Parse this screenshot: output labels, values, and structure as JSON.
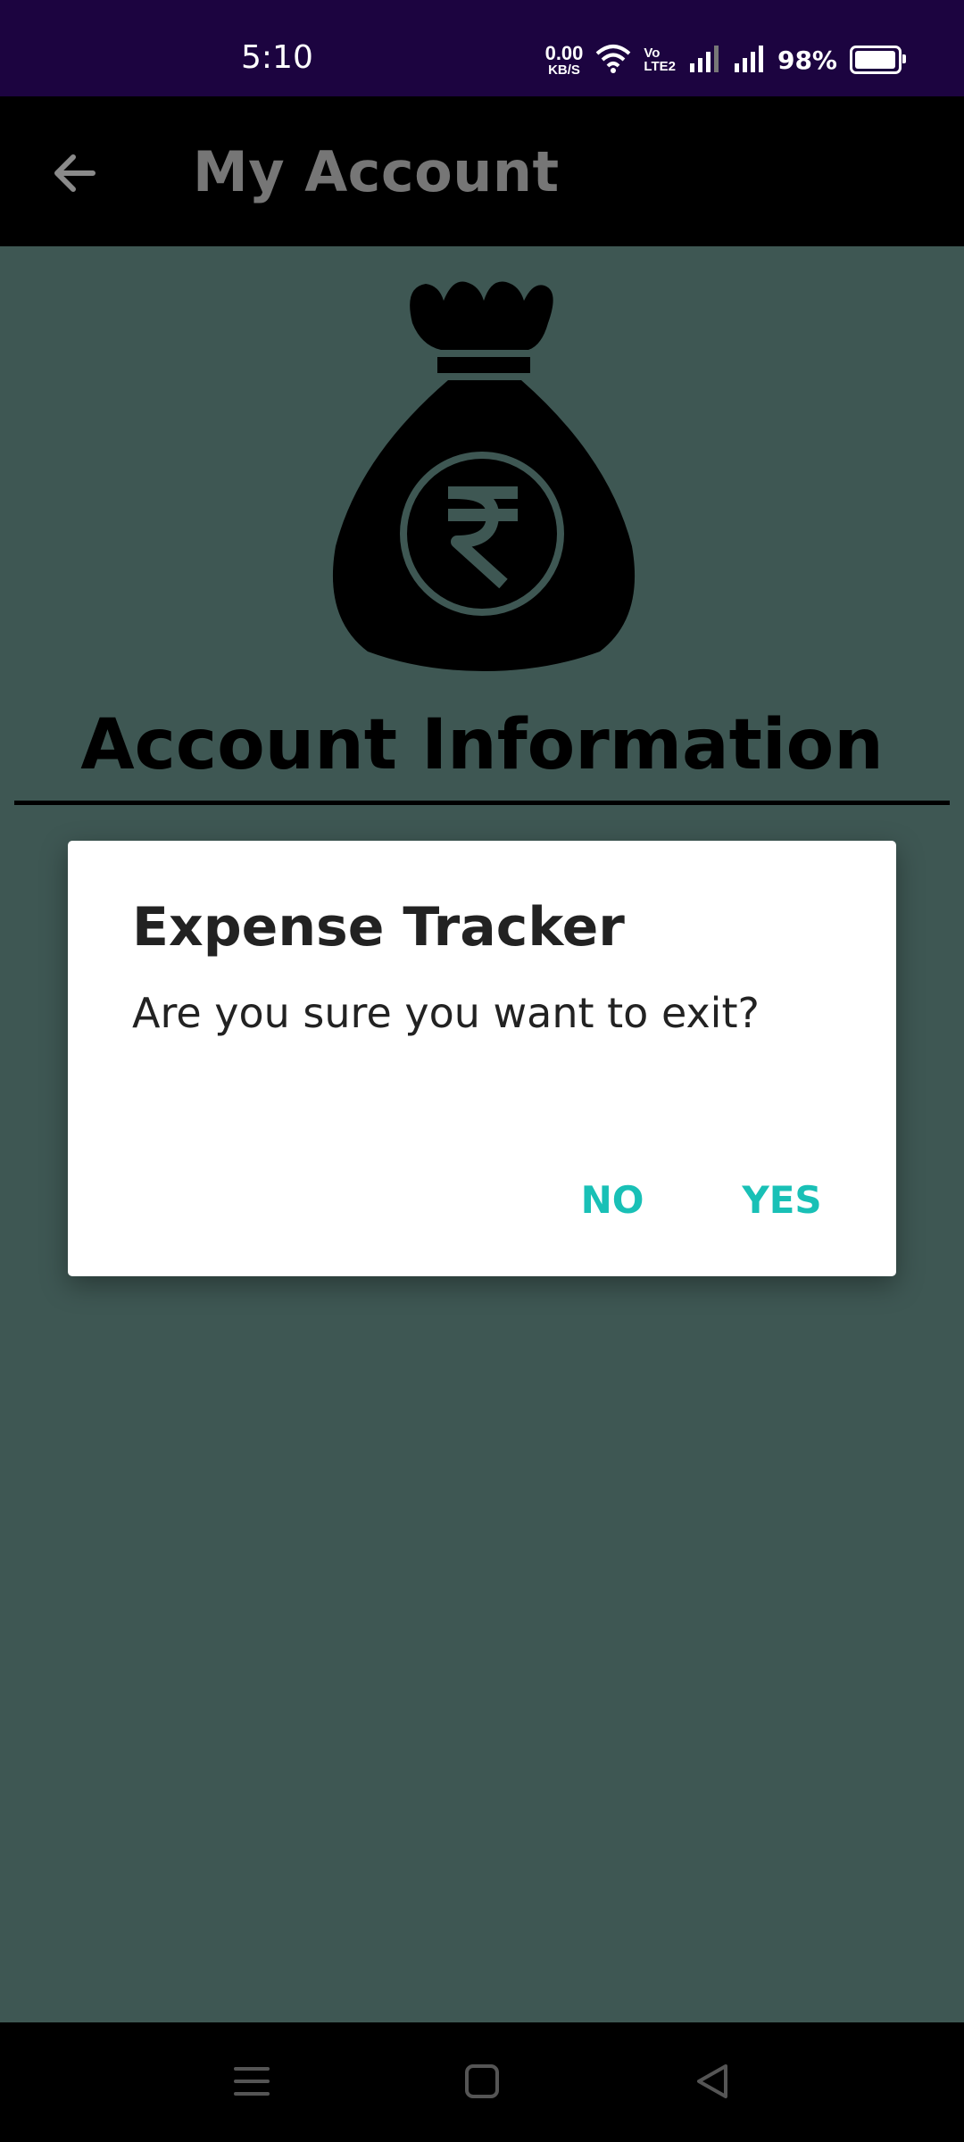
{
  "status_bar": {
    "time": "5:10",
    "net_speed_value": "0.00",
    "net_speed_unit": "KB/S",
    "volte_top": "Vo",
    "volte_bottom": "LTE2",
    "battery": "98%"
  },
  "app_bar": {
    "title": "My Account",
    "back_icon": "arrow-left-icon"
  },
  "content": {
    "illustration_icon": "rupee-money-bag-icon",
    "section_title": "Account Information"
  },
  "dialog": {
    "title": "Expense Tracker",
    "message": "Are you sure you want to exit?",
    "no_label": "NO",
    "yes_label": "YES"
  },
  "nav_bar": {
    "menu_icon": "menu-icon",
    "home_icon": "home-square-icon",
    "back_icon": "back-triangle-icon"
  },
  "colors": {
    "status_bar_bg": "#1c0440",
    "app_bar_bg": "#000000",
    "page_bg": "#3e5753",
    "accent": "#19c0b6"
  }
}
